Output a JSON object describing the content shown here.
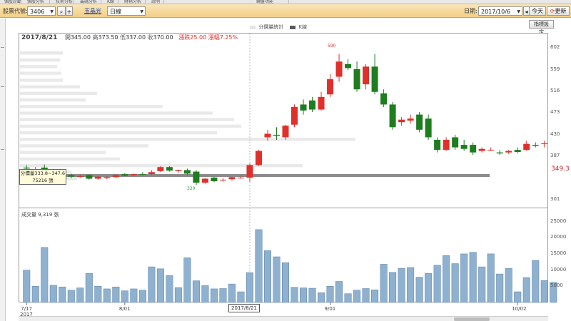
{
  "top_tabs": [
    "個股診斷",
    "個股分析",
    "技術分析",
    "籌碼分析",
    "K線",
    "財務分析",
    "說明",
    "輔盤功能"
  ],
  "toolbar": {
    "stock_code_label": "股票代號:",
    "stock_code_value": "3406",
    "stock_name": "玉晶光",
    "period_value": "日線",
    "date_label": "日期:",
    "date_value": "2017/10/6",
    "today_label": "今天",
    "refresh_label": "更新"
  },
  "settings_label": "指標設定",
  "legend": {
    "dist_label": "分價量統計",
    "k_label": "K線",
    "dist_color": "#e5e5e5",
    "k_color": "#5a5a5a"
  },
  "ohlc": {
    "date": "2017/8/21",
    "open_label": "開",
    "open": "345.00",
    "high_label": "高",
    "high": "373.50",
    "low_label": "低",
    "low": "337.00",
    "close_label": "收",
    "close": "370.00",
    "change_label": "漲跌",
    "change": "25.00",
    "pct_label": "漲幅",
    "pct": "7.25%"
  },
  "tooltip": {
    "range": "分價量333.8~347.6",
    "volume": "75216 張"
  },
  "current_price": "349.3",
  "volume": {
    "title_label": "成交量",
    "title_value": "9,319 張"
  },
  "x_selected": "2017/8/21",
  "high_marker": "590",
  "low_marker": "320",
  "colors": {
    "up": "#e0302c",
    "down": "#1e7d1e",
    "vol": "#8fb1d0",
    "vol_border": "#5a7fa8",
    "ma": "#808080"
  },
  "chart_data": {
    "type": "candlestick",
    "y_axis": {
      "labels": [
        "602",
        "559",
        "516",
        "473",
        "430",
        "387",
        "301"
      ],
      "min": 290,
      "max": 615
    },
    "volume_axis": {
      "labels": [
        "25000",
        "20000",
        "15000",
        "10000",
        "5000"
      ],
      "min": 0,
      "max": 26000
    },
    "x_labels": [
      {
        "label": "7/17",
        "sub": "2017",
        "index": 0
      },
      {
        "label": "8/01",
        "index": 11
      },
      {
        "label": "9/01",
        "index": 34
      },
      {
        "label": "10/02",
        "index": 55
      }
    ],
    "candles": [
      {
        "o": 365,
        "h": 370,
        "l": 358,
        "c": 363
      },
      {
        "o": 362,
        "h": 366,
        "l": 355,
        "c": 360
      },
      {
        "o": 365,
        "h": 371,
        "l": 349,
        "c": 352
      },
      {
        "o": 350,
        "h": 354,
        "l": 345,
        "c": 348
      },
      {
        "o": 351,
        "h": 355,
        "l": 346,
        "c": 349
      },
      {
        "o": 350,
        "h": 353,
        "l": 344,
        "c": 347
      },
      {
        "o": 347,
        "h": 351,
        "l": 345,
        "c": 348
      },
      {
        "o": 350,
        "h": 352,
        "l": 341,
        "c": 343
      },
      {
        "o": 343,
        "h": 348,
        "l": 341,
        "c": 347
      },
      {
        "o": 344,
        "h": 348,
        "l": 342,
        "c": 346
      },
      {
        "o": 346,
        "h": 352,
        "l": 344,
        "c": 350
      },
      {
        "o": 352,
        "h": 354,
        "l": 348,
        "c": 349
      },
      {
        "o": 350,
        "h": 353,
        "l": 348,
        "c": 352
      },
      {
        "o": 352,
        "h": 356,
        "l": 350,
        "c": 351
      },
      {
        "o": 352,
        "h": 360,
        "l": 350,
        "c": 356
      },
      {
        "o": 358,
        "h": 368,
        "l": 356,
        "c": 366
      },
      {
        "o": 366,
        "h": 368,
        "l": 357,
        "c": 359
      },
      {
        "o": 358,
        "h": 361,
        "l": 355,
        "c": 360
      },
      {
        "o": 360,
        "h": 363,
        "l": 350,
        "c": 353
      },
      {
        "o": 357,
        "h": 360,
        "l": 330,
        "c": 335
      },
      {
        "o": 335,
        "h": 344,
        "l": 333,
        "c": 343
      },
      {
        "o": 345,
        "h": 347,
        "l": 336,
        "c": 338
      },
      {
        "o": 340,
        "h": 344,
        "l": 337,
        "c": 341
      },
      {
        "o": 342,
        "h": 347,
        "l": 339,
        "c": 346
      },
      {
        "o": 345,
        "h": 349,
        "l": 343,
        "c": 345
      },
      {
        "o": 345,
        "h": 373,
        "l": 337,
        "c": 370
      },
      {
        "o": 370,
        "h": 400,
        "l": 368,
        "c": 398
      },
      {
        "o": 425,
        "h": 440,
        "l": 418,
        "c": 432
      },
      {
        "o": 430,
        "h": 445,
        "l": 420,
        "c": 428
      },
      {
        "o": 425,
        "h": 450,
        "l": 420,
        "c": 448
      },
      {
        "o": 450,
        "h": 490,
        "l": 445,
        "c": 485
      },
      {
        "o": 490,
        "h": 500,
        "l": 470,
        "c": 478
      },
      {
        "o": 498,
        "h": 505,
        "l": 475,
        "c": 480
      },
      {
        "o": 480,
        "h": 515,
        "l": 478,
        "c": 505
      },
      {
        "o": 510,
        "h": 550,
        "l": 505,
        "c": 540
      },
      {
        "o": 545,
        "h": 590,
        "l": 535,
        "c": 575
      },
      {
        "o": 570,
        "h": 580,
        "l": 558,
        "c": 562
      },
      {
        "o": 560,
        "h": 575,
        "l": 515,
        "c": 520
      },
      {
        "o": 530,
        "h": 570,
        "l": 520,
        "c": 565
      },
      {
        "o": 565,
        "h": 590,
        "l": 510,
        "c": 515
      },
      {
        "o": 512,
        "h": 520,
        "l": 485,
        "c": 490
      },
      {
        "o": 490,
        "h": 495,
        "l": 440,
        "c": 445
      },
      {
        "o": 455,
        "h": 465,
        "l": 448,
        "c": 460
      },
      {
        "o": 458,
        "h": 470,
        "l": 452,
        "c": 462
      },
      {
        "o": 470,
        "h": 475,
        "l": 435,
        "c": 440
      },
      {
        "o": 462,
        "h": 470,
        "l": 420,
        "c": 425
      },
      {
        "o": 420,
        "h": 425,
        "l": 395,
        "c": 400
      },
      {
        "o": 400,
        "h": 425,
        "l": 398,
        "c": 420
      },
      {
        "o": 425,
        "h": 430,
        "l": 400,
        "c": 405
      },
      {
        "o": 410,
        "h": 420,
        "l": 398,
        "c": 402
      },
      {
        "o": 410,
        "h": 415,
        "l": 390,
        "c": 395
      },
      {
        "o": 398,
        "h": 405,
        "l": 395,
        "c": 402
      },
      {
        "o": 400,
        "h": 405,
        "l": 398,
        "c": 400
      },
      {
        "o": 395,
        "h": 400,
        "l": 390,
        "c": 393
      },
      {
        "o": 395,
        "h": 400,
        "l": 392,
        "c": 398
      },
      {
        "o": 400,
        "h": 405,
        "l": 393,
        "c": 396
      },
      {
        "o": 400,
        "h": 418,
        "l": 398,
        "c": 412
      },
      {
        "o": 410,
        "h": 415,
        "l": 405,
        "c": 408
      },
      {
        "o": 412,
        "h": 418,
        "l": 405,
        "c": 413
      }
    ],
    "volume": [
      10000,
      5000,
      17000,
      5300,
      4800,
      3800,
      4500,
      9000,
      5000,
      4200,
      4800,
      3600,
      4200,
      3800,
      11000,
      10400,
      8300,
      4600,
      13800,
      6700,
      5200,
      4200,
      4300,
      5700,
      3300,
      9200,
      22500,
      16000,
      14100,
      12300,
      4700,
      4500,
      4400,
      3000,
      5000,
      6500,
      2700,
      3800,
      4300,
      3900,
      11800,
      9300,
      10500,
      10800,
      7800,
      9000,
      11500,
      14500,
      12000,
      15000,
      15500,
      11000,
      15000,
      8800,
      10500,
      3300,
      7700,
      13000,
      6800,
      6200
    ],
    "price_distribution": [
      {
        "price": 592,
        "w": 60
      },
      {
        "price": 578,
        "w": 56
      },
      {
        "price": 565,
        "w": 52
      },
      {
        "price": 552,
        "w": 58
      },
      {
        "price": 538,
        "w": 60
      },
      {
        "price": 525,
        "w": 84
      },
      {
        "price": 512,
        "w": 108
      },
      {
        "price": 499,
        "w": 92
      },
      {
        "price": 486,
        "w": 200
      },
      {
        "price": 473,
        "w": 270
      },
      {
        "price": 460,
        "w": 300
      },
      {
        "price": 447,
        "w": 310
      },
      {
        "price": 434,
        "w": 276
      },
      {
        "price": 421,
        "w": 470
      },
      {
        "price": 408,
        "w": 180
      },
      {
        "price": 395,
        "w": 120
      },
      {
        "price": 382,
        "w": 140
      },
      {
        "price": 369,
        "w": 396
      },
      {
        "price": 356,
        "w": 72
      },
      {
        "price": 349,
        "w": 658
      },
      {
        "price": 343,
        "w": 80
      }
    ]
  }
}
